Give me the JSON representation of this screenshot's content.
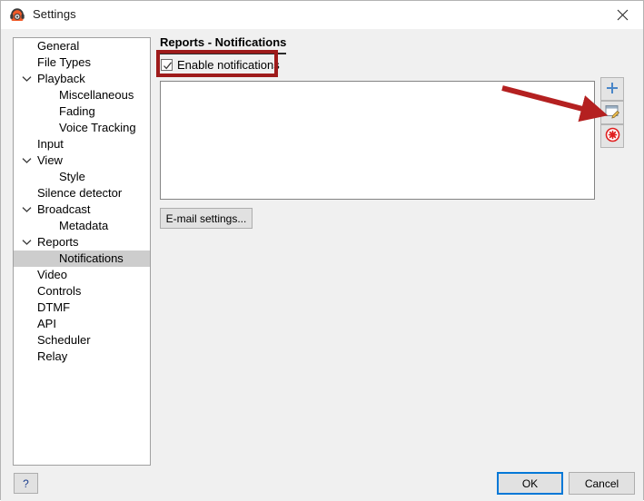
{
  "window": {
    "title": "Settings",
    "app_icon": "radio-headphones-icon",
    "close_icon": "close-icon"
  },
  "sidebar": {
    "items": [
      {
        "label": "General",
        "level": 0,
        "expander": "none",
        "selected": false
      },
      {
        "label": "File Types",
        "level": 0,
        "expander": "none",
        "selected": false
      },
      {
        "label": "Playback",
        "level": 0,
        "expander": "expanded",
        "selected": false
      },
      {
        "label": "Miscellaneous",
        "level": 1,
        "expander": "none",
        "selected": false
      },
      {
        "label": "Fading",
        "level": 1,
        "expander": "none",
        "selected": false
      },
      {
        "label": "Voice Tracking",
        "level": 1,
        "expander": "none",
        "selected": false
      },
      {
        "label": "Input",
        "level": 0,
        "expander": "none",
        "selected": false
      },
      {
        "label": "View",
        "level": 0,
        "expander": "expanded",
        "selected": false
      },
      {
        "label": "Style",
        "level": 1,
        "expander": "none",
        "selected": false
      },
      {
        "label": "Silence detector",
        "level": 0,
        "expander": "none",
        "selected": false
      },
      {
        "label": "Broadcast",
        "level": 0,
        "expander": "expanded",
        "selected": false
      },
      {
        "label": "Metadata",
        "level": 1,
        "expander": "none",
        "selected": false
      },
      {
        "label": "Reports",
        "level": 0,
        "expander": "expanded",
        "selected": false
      },
      {
        "label": "Notifications",
        "level": 1,
        "expander": "none",
        "selected": true
      },
      {
        "label": "Video",
        "level": 0,
        "expander": "none",
        "selected": false
      },
      {
        "label": "Controls",
        "level": 0,
        "expander": "none",
        "selected": false
      },
      {
        "label": "DTMF",
        "level": 0,
        "expander": "none",
        "selected": false
      },
      {
        "label": "API",
        "level": 0,
        "expander": "none",
        "selected": false
      },
      {
        "label": "Scheduler",
        "level": 0,
        "expander": "none",
        "selected": false
      },
      {
        "label": "Relay",
        "level": 0,
        "expander": "none",
        "selected": false
      }
    ]
  },
  "main": {
    "section_title": "Reports - Notifications",
    "enable_checkbox": {
      "label": "Enable notifications",
      "checked": true
    },
    "notifications_list": {
      "items": [],
      "empty": true
    },
    "email_settings_label": "E-mail settings...",
    "tool_buttons": [
      {
        "name": "add-button",
        "icon": "plus-icon",
        "tooltip": "Add"
      },
      {
        "name": "edit-button",
        "icon": "edit-pencil-icon",
        "tooltip": "Edit"
      },
      {
        "name": "delete-button",
        "icon": "delete-circle-icon",
        "tooltip": "Delete"
      }
    ]
  },
  "footer": {
    "help_label": "?",
    "ok_label": "OK",
    "cancel_label": "Cancel"
  },
  "annotations": {
    "highlight_color": "#9e1b1b",
    "arrow_color": "#b42020",
    "highlight_target": "enable-notifications-checkbox",
    "arrow_target": "add-button"
  },
  "colors": {
    "dialog_background": "#f0f0f0",
    "panel_white": "#ffffff",
    "selection_gray": "#cdcdcd",
    "accent_blue": "#0078d7",
    "plus_blue": "#4a86c8",
    "delete_red": "#e02020"
  }
}
